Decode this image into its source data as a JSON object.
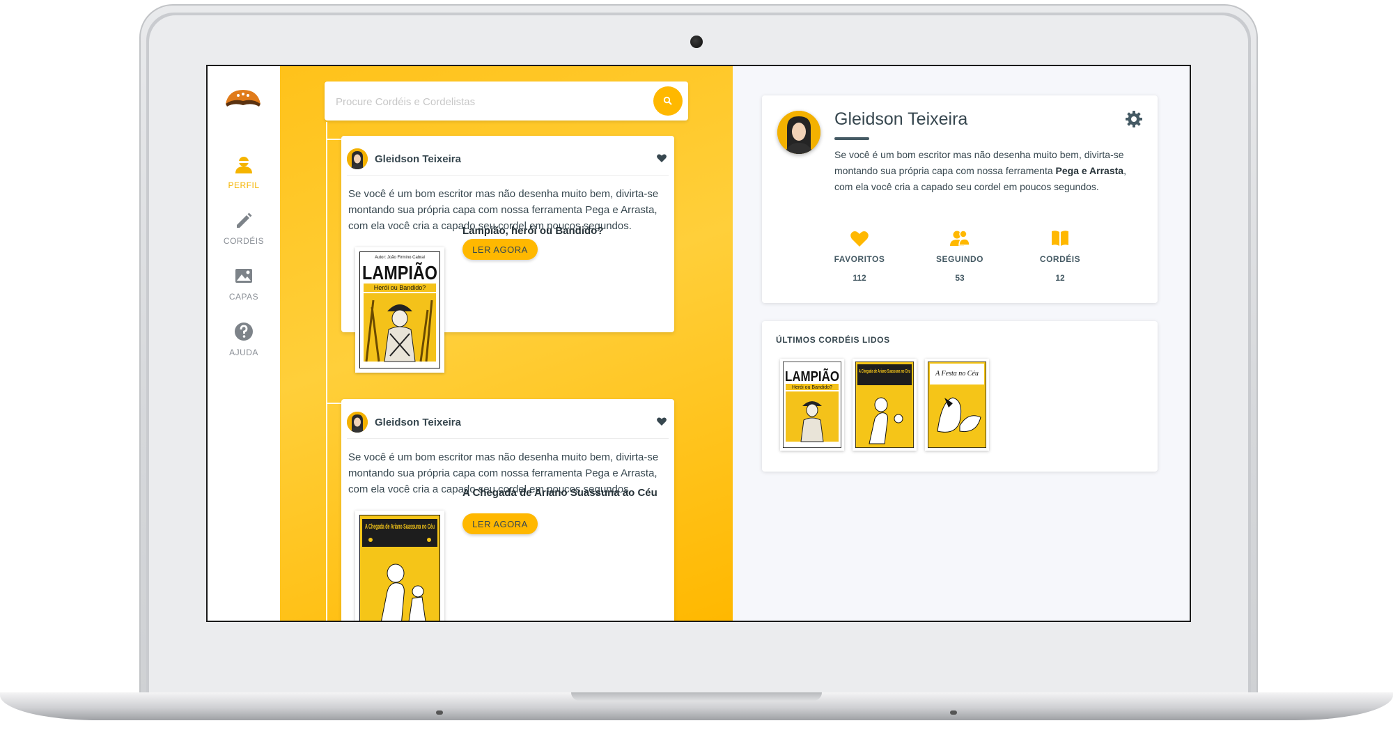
{
  "sidebar": {
    "items": [
      {
        "label": "PERFIL",
        "icon": "user-icon",
        "active": true
      },
      {
        "label": "CORDÉIS",
        "icon": "pencil-icon",
        "active": false
      },
      {
        "label": "CAPAS",
        "icon": "image-icon",
        "active": false
      },
      {
        "label": "AJUDA",
        "icon": "help-icon",
        "active": false
      }
    ],
    "logo": "hat-logo"
  },
  "search": {
    "placeholder": "Procure Cordéis e Cordelistas",
    "value": ""
  },
  "feed": {
    "posts": [
      {
        "author": "Gleidson Teixeira",
        "text": "Se você é um bom escritor mas não desenha muito bem, divirta-se montando sua própria capa com nossa ferramenta Pega e Arrasta, com ela você cria a capado seu cordel em poucos segundos.",
        "book_title": "Lampião, herói ou Bandido?",
        "read_label": "LER AGORA",
        "cover": {
          "top_text": "Autor: João Firmino Cabral",
          "title": "LAMPIÃO",
          "subtitle": "Herói ou Bandido?"
        }
      },
      {
        "author": "Gleidson Teixeira",
        "text": "Se você é um bom escritor mas não desenha muito bem, divirta-se montando sua própria capa com nossa ferramenta Pega e Arrasta, com ela você cria a capado seu cordel em poucos segundos.",
        "book_title": "A Chegada de Ariano Suassuna ao Céu",
        "read_label": "LER AGORA",
        "cover": {
          "title": "A Chegada de Ariano Suassuna no Céu"
        }
      }
    ]
  },
  "profile": {
    "name": "Gleidson Teixeira",
    "bio_start": "Se você é um bom escritor mas não desenha muito bem, divirta-se montando sua própria capa com nossa ferramenta ",
    "bio_bold": "Pega e Arrasta",
    "bio_end": ", com ela você cria a capado seu cordel em poucos segundos.",
    "stats": [
      {
        "label": "FAVORITOS",
        "value": "112",
        "icon": "heart-icon"
      },
      {
        "label": "SEGUINDO",
        "value": "53",
        "icon": "users-icon"
      },
      {
        "label": "CORDÉIS",
        "value": "12",
        "icon": "book-icon"
      }
    ]
  },
  "recent": {
    "title": "ÚLTIMOS CORDÉIS LIDOS",
    "covers": [
      {
        "title": "LAMPIÃO",
        "subtitle": "Herói ou Bandido?"
      },
      {
        "title": "A Chegada de Ariano Suassuna no Céu"
      },
      {
        "title": "A Festa no Céu"
      }
    ]
  },
  "colors": {
    "accent": "#ffb800",
    "text": "#37474f",
    "sidebar_inactive": "#8a8f96"
  }
}
